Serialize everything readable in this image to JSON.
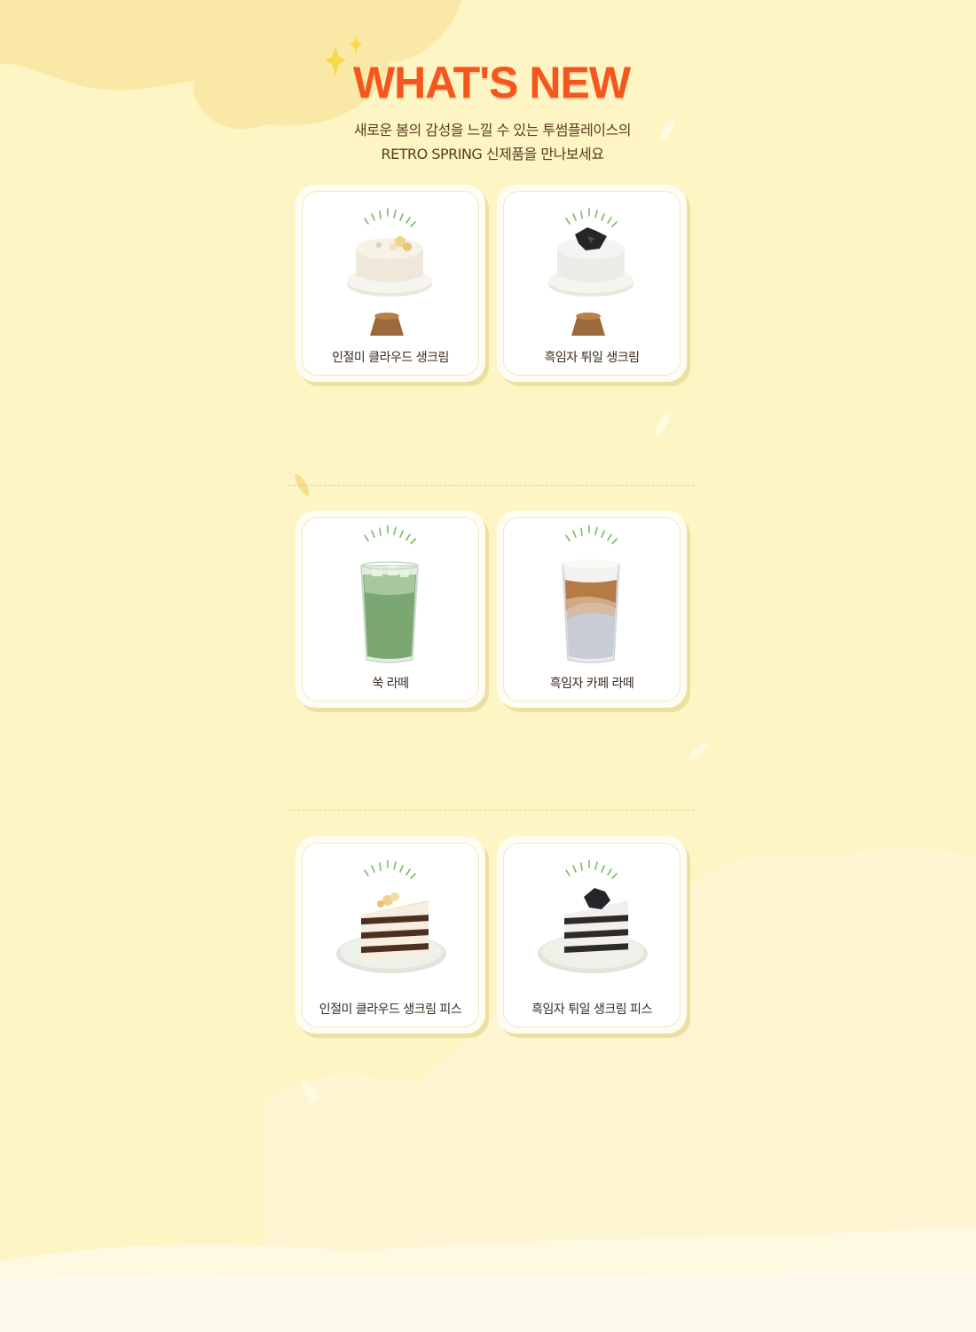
{
  "header": {
    "title": "WHAT'S NEW",
    "subtitle_line1": "새로운 봄의 감성을 느낄 수 있는 투썸플레이스의",
    "subtitle_line2": "RETRO SPRING 신제품을 만나보세요"
  },
  "products": [
    {
      "name": "인절미 클라우드 생크림",
      "icon": "injeolmi-cake-whole-icon"
    },
    {
      "name": "흑임자 튀일 생크림",
      "icon": "black-sesame-cake-whole-icon"
    },
    {
      "name": "쑥 라떼",
      "icon": "mugwort-latte-icon"
    },
    {
      "name": "흑임자 카페 라떼",
      "icon": "black-sesame-cafe-latte-icon"
    },
    {
      "name": "인절미 클라우드 생크림 피스",
      "icon": "injeolmi-cake-slice-icon"
    },
    {
      "name": "흑임자 튀일 생크림 피스",
      "icon": "black-sesame-cake-slice-icon"
    }
  ],
  "colors": {
    "background": "#fdf5c4",
    "title": "#f5561e",
    "subtitle": "#5a3b23",
    "sparkle": "#f7d94c",
    "burst_lines": "#7fb86a"
  }
}
